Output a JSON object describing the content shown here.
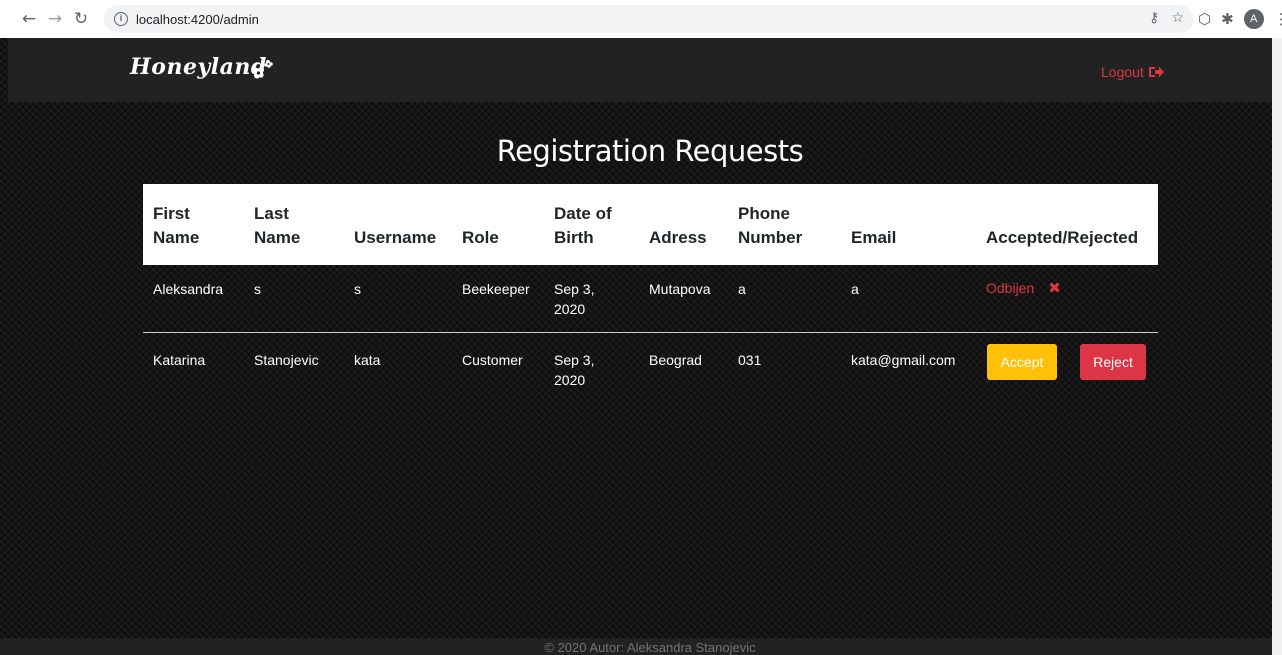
{
  "browser": {
    "url": "localhost:4200/admin",
    "avatar_letter": "A"
  },
  "header": {
    "brand": "Honeyland",
    "logout_label": "Logout"
  },
  "page": {
    "title": "Registration Requests"
  },
  "table": {
    "columns": [
      "First Name",
      "Last Name",
      "Username",
      "Role",
      "Date of Birth",
      "Adress",
      "Phone Number",
      "Email",
      "Accepted/Rejected"
    ],
    "rows": [
      {
        "first_name": "Aleksandra",
        "last_name": "s",
        "username": "s",
        "role": "Beekeeper",
        "date_of_birth": "Sep 3, 2020",
        "address": "Mutapova",
        "phone": "a",
        "email": "a",
        "status": "Odbijen"
      },
      {
        "first_name": "Katarina",
        "last_name": "Stanojevic",
        "username": "kata",
        "role": "Customer",
        "date_of_birth": "Sep 3, 2020",
        "address": "Beograd",
        "phone": "031",
        "email": "kata@gmail.com",
        "accept_label": "Accept",
        "reject_label": "Reject"
      }
    ]
  },
  "footer": {
    "text": "© 2020 Autor: Aleksandra Stanojevic"
  },
  "colors": {
    "danger": "#dc3545",
    "warning": "#ffc107",
    "navbar": "#222222"
  }
}
